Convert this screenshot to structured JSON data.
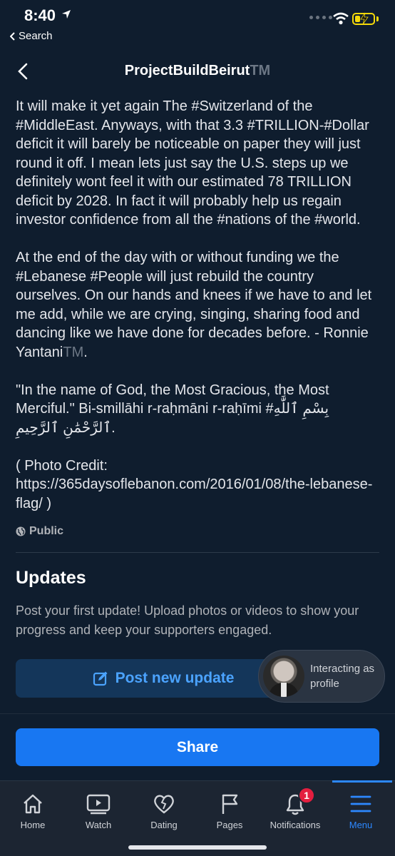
{
  "status_bar": {
    "time": "8:40",
    "back_app_label": "Search",
    "battery_percent": 30
  },
  "header": {
    "title": "ProjectBuildBeirut",
    "title_tm": "TM"
  },
  "post": {
    "para1": "It will make it yet again The #Switzerland of the #MiddleEast. Anyways, with that 3.3 #TRILLION-#Dollar deficit it will barely be noticeable on paper they will just round it off. I mean lets just say the U.S. steps up we definitely wont feel it with our estimated 78 TRILLION deficit by 2028. In fact it will probably help us regain investor confidence from all the #nations of the #world.",
    "para2_main": "At the end of the day with or without funding we the #Lebanese #People will just rebuild the country ourselves. On our hands and knees if we have to and let me add, while we are crying, singing, sharing food and dancing like we have done for decades before. - Ronnie Yantani",
    "para2_tm": "TM",
    "para2_end": ".",
    "para3": "\"In the name of God, the Most Gracious, the Most Merciful.\" Bi-smillāhi r-raḥmāni r-raḥīmi #بِسْمِ ٱللَّٰهِ ٱلرَّحْمَٰنِ ٱلرَّحِيمِ.",
    "para4": "( Photo Credit: https://365daysoflebanon.com/2016/01/08/the-lebanese-flag/ )",
    "privacy": "Public"
  },
  "updates": {
    "title": "Updates",
    "description": "Post your first update! Upload photos or videos to show your progress and keep your supporters engaged.",
    "post_button": "Post new update"
  },
  "interacting": {
    "text_line1": "Interacting as",
    "text_line2": "profile"
  },
  "share_button": "Share",
  "bottom_nav": {
    "items": [
      {
        "label": "Home",
        "icon": "home-icon"
      },
      {
        "label": "Watch",
        "icon": "watch-icon"
      },
      {
        "label": "Dating",
        "icon": "heart-icon"
      },
      {
        "label": "Pages",
        "icon": "flag-icon"
      },
      {
        "label": "Notifications",
        "icon": "bell-icon",
        "badge": "1"
      },
      {
        "label": "Menu",
        "icon": "menu-icon",
        "active": true
      }
    ]
  },
  "colors": {
    "background": "#0f1d2e",
    "accent": "#1877f2",
    "link": "#4ba3ff",
    "badge": "#e41e3f"
  }
}
